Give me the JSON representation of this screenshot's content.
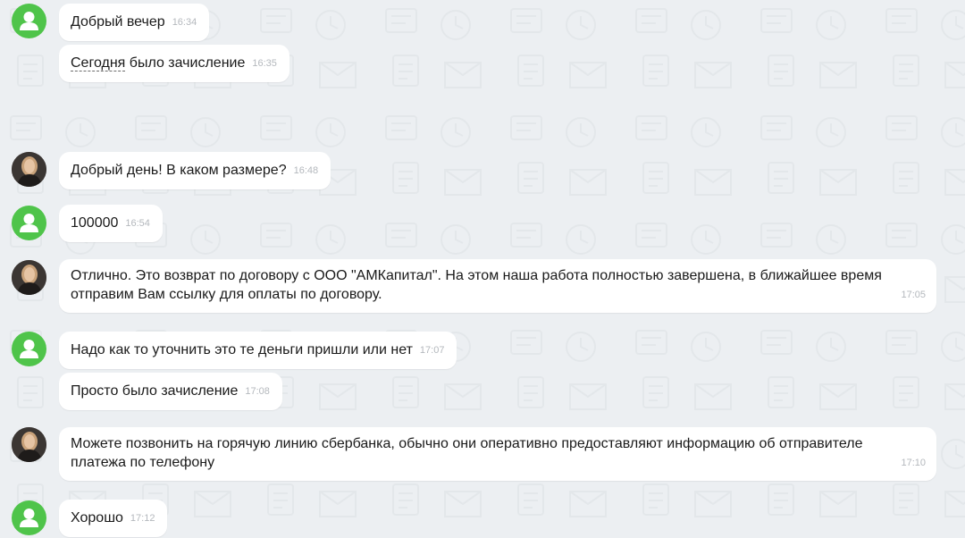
{
  "colors": {
    "background": "#eceff2",
    "bubble": "#ffffff",
    "user_avatar": "#4fc44a",
    "time_text": "#b4b8bd"
  },
  "messages": [
    {
      "sender": "client",
      "text": "Добрый вечер",
      "time": "16:34"
    },
    {
      "sender": "client",
      "text_underlined": "Сегодня",
      "text": " было зачисление",
      "time": "16:35"
    },
    {
      "sender": "operator",
      "text": "Добрый день! В каком размере?",
      "time": "16:48"
    },
    {
      "sender": "client",
      "text": "100000",
      "time": "16:54"
    },
    {
      "sender": "operator",
      "text": "Отлично. Это возврат по договору с ООО \"АМКапитал\". На этом наша работа полностью завершена, в ближайшее время отправим Вам ссылку для оплаты по договору.",
      "time": "17:05"
    },
    {
      "sender": "client",
      "text": "Надо как то уточнить это те деньги пришли или нет",
      "time": "17:07"
    },
    {
      "sender": "client",
      "text": "Просто было зачисление",
      "time": "17:08"
    },
    {
      "sender": "operator",
      "text": "Можете позвонить на горячую линию сбербанка, обычно они оперативно предоставляют информацию об отправителе платежа по телефону",
      "time": "17:10"
    },
    {
      "sender": "client",
      "text": "Хорошо",
      "time": "17:12"
    }
  ],
  "icons": {
    "client_avatar": "user-silhouette-icon",
    "operator_avatar": "operator-photo-avatar"
  }
}
